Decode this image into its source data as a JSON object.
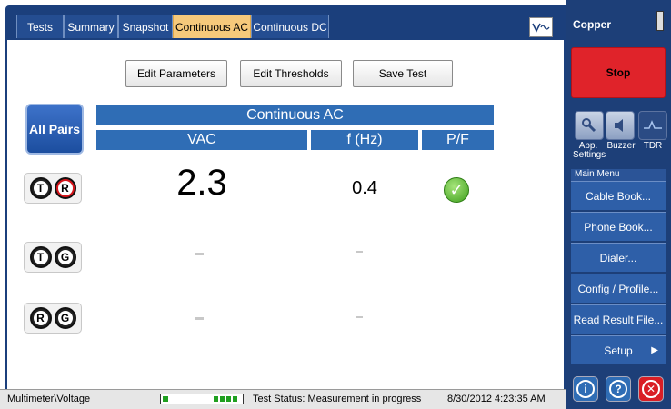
{
  "tabs": [
    {
      "label": "Tests"
    },
    {
      "label": "Summary"
    },
    {
      "label": "Snapshot"
    },
    {
      "label": "Continuous AC",
      "active": true
    },
    {
      "label": "Continuous DC"
    }
  ],
  "toolbar": {
    "edit_parameters": "Edit Parameters",
    "edit_thresholds": "Edit Thresholds",
    "save_test": "Save Test"
  },
  "all_pairs_label": "All Pairs",
  "table": {
    "title": "Continuous AC",
    "headers": [
      "VAC",
      "f (Hz)",
      "P/F"
    ],
    "rows": [
      {
        "pair": [
          "T",
          "R"
        ],
        "vac": "2.3",
        "freq": "0.4",
        "pf": "pass"
      },
      {
        "pair": [
          "T",
          "G"
        ],
        "vac": "–",
        "freq": "–",
        "pf": ""
      },
      {
        "pair": [
          "R",
          "G"
        ],
        "vac": "–",
        "freq": "–",
        "pf": ""
      }
    ]
  },
  "status": {
    "path": "Multimeter\\Voltage",
    "test_status": "Test Status: Measurement in progress",
    "datetime": "8/30/2012 4:23:35 AM"
  },
  "right_panel": {
    "title": "Copper",
    "stop": "Stop",
    "icons": [
      {
        "label": "App. Settings",
        "icon": "wrench-icon"
      },
      {
        "label": "Buzzer",
        "icon": "speaker-icon"
      },
      {
        "label": "TDR",
        "icon": "waveform-icon"
      }
    ],
    "menu_header": "Main Menu",
    "menu_items": [
      "Cable Book...",
      "Phone Book...",
      "Dialer...",
      "Config / Profile...",
      "Read Result File...",
      "Setup"
    ]
  },
  "colors": {
    "accent": "#1b3f7c",
    "header": "#2f6db5",
    "active_tab": "#f6c97b",
    "stop": "#e0232a",
    "pass": "#3d9e1c"
  }
}
